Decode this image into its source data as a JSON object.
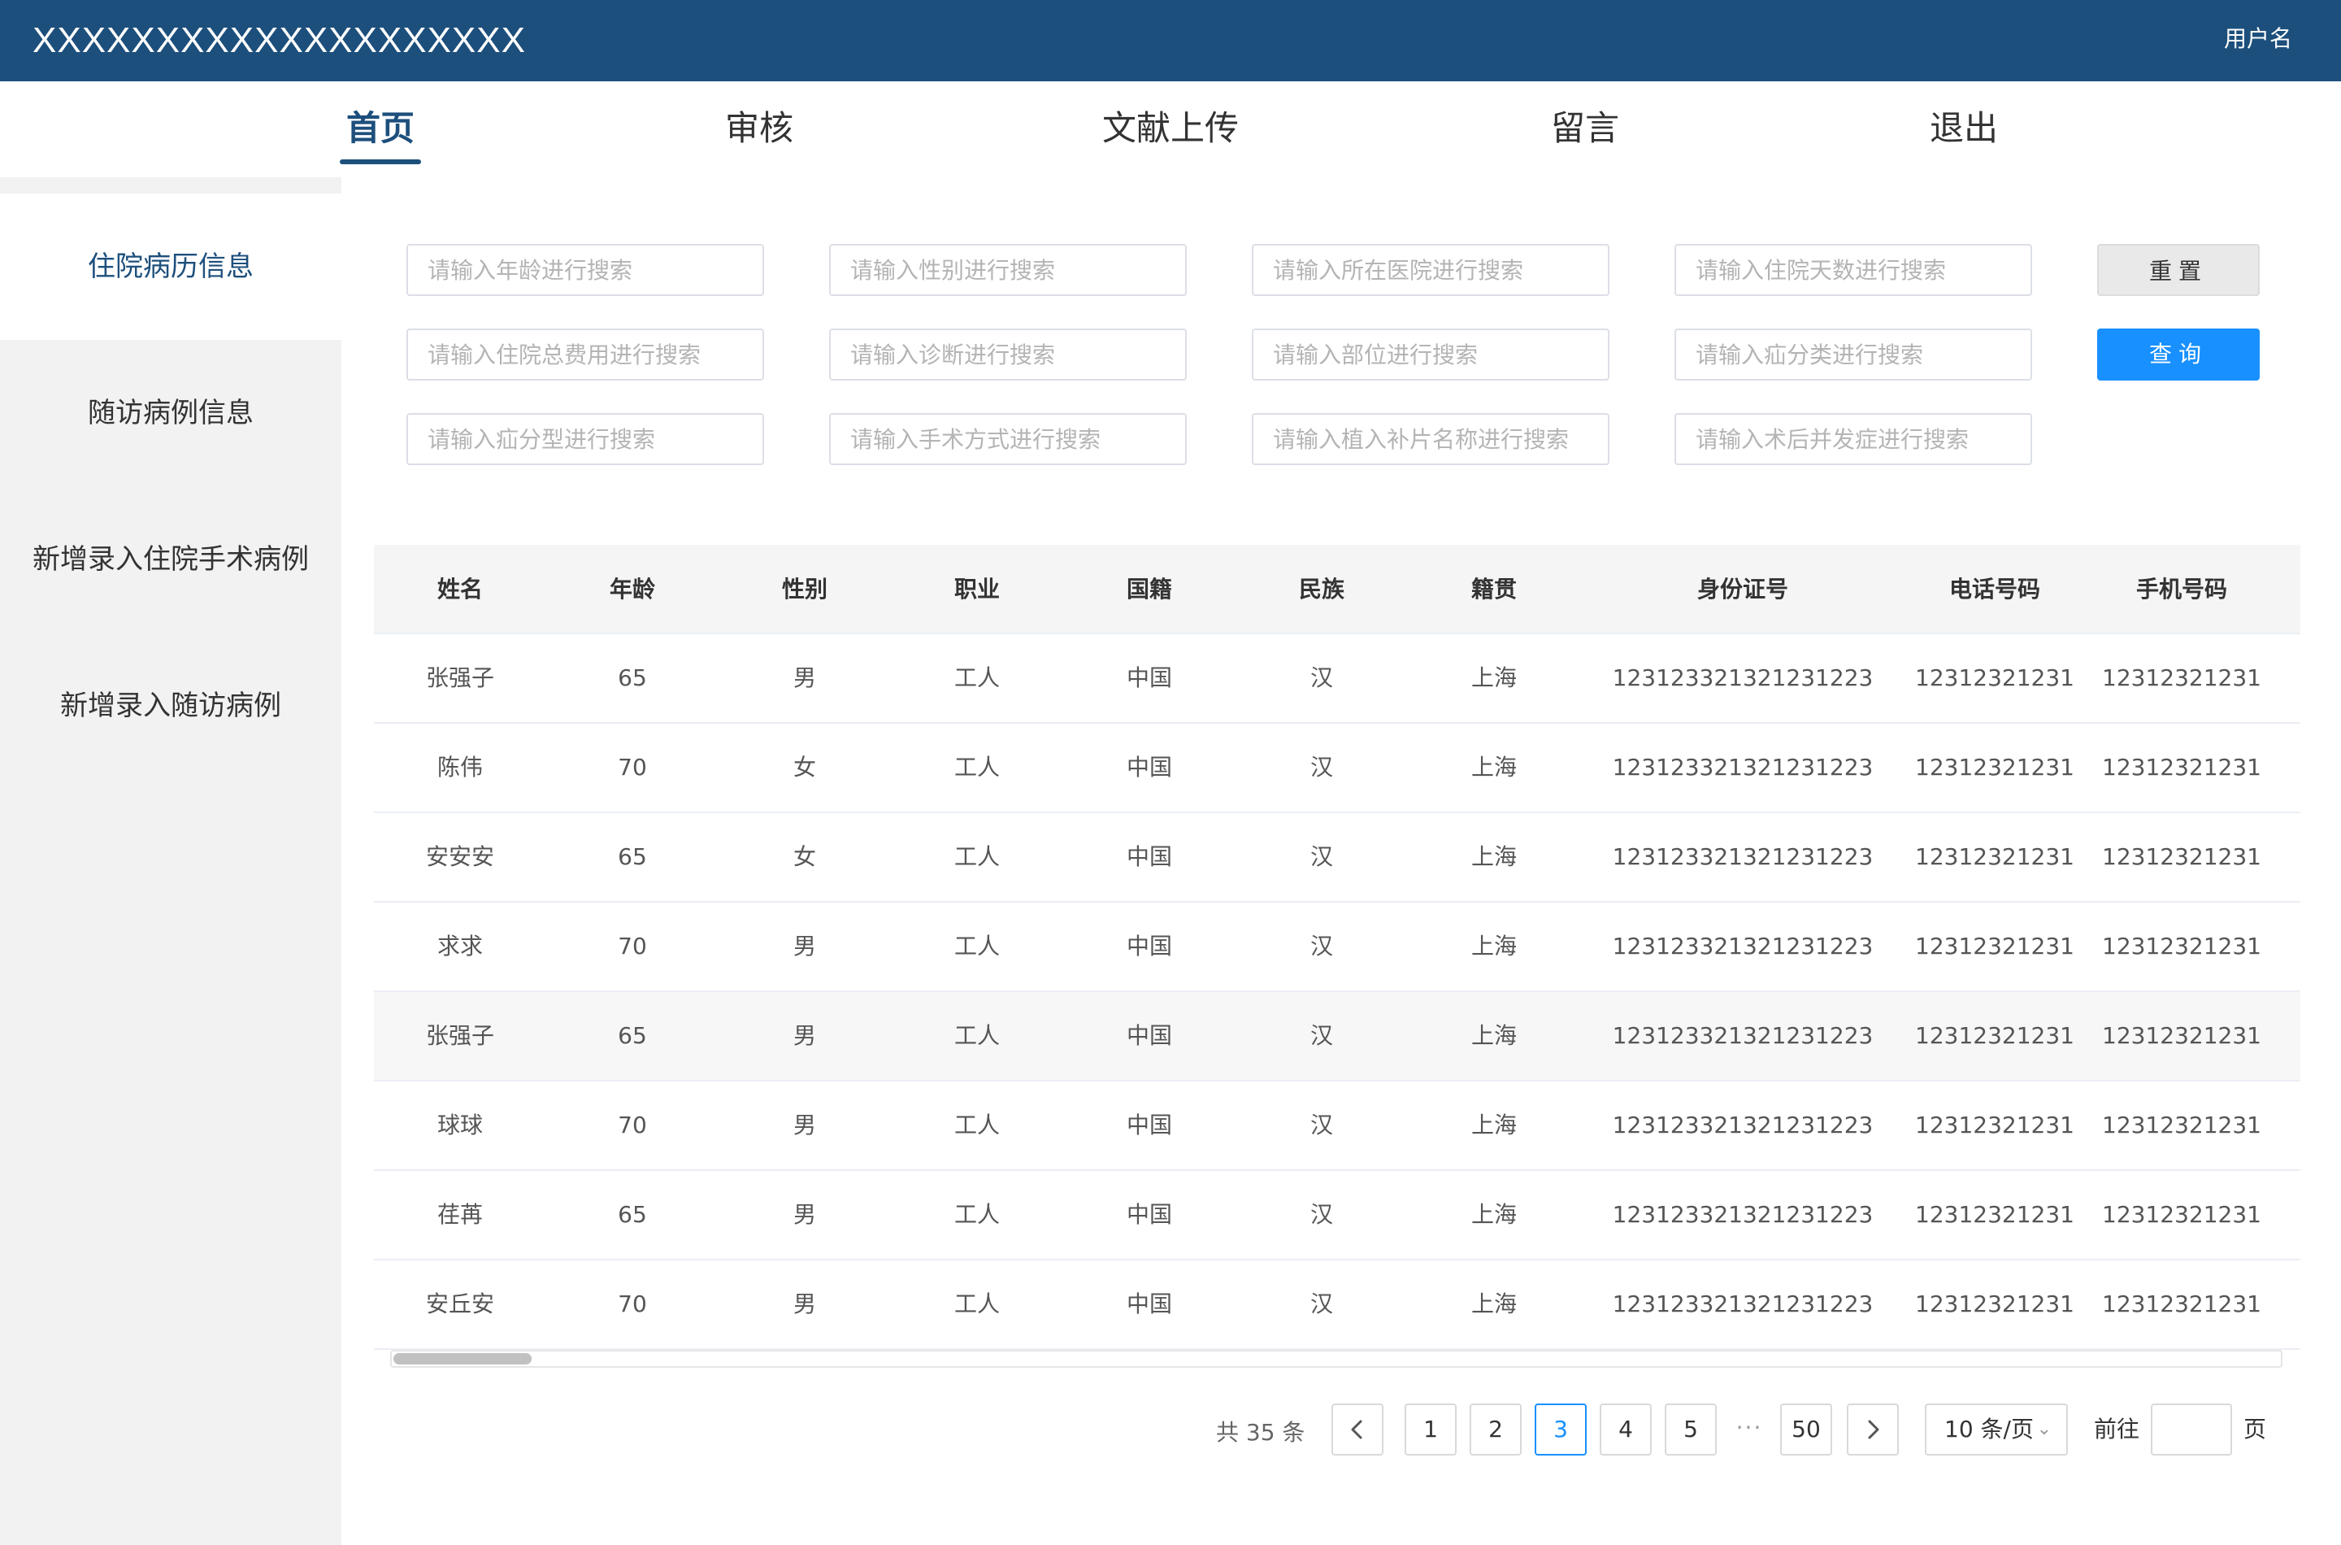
{
  "header": {
    "app_title": "XXXXXXXXXXXXXXXXXXXX",
    "username": "用户名"
  },
  "nav": {
    "tabs": [
      {
        "label": "首页"
      },
      {
        "label": "审核"
      },
      {
        "label": "文献上传"
      },
      {
        "label": "留言"
      },
      {
        "label": "退出"
      }
    ],
    "active_index": 0
  },
  "sidebar": {
    "items": [
      {
        "label": "住院病历信息"
      },
      {
        "label": "随访病例信息"
      },
      {
        "label": "新增录入住院手术病例"
      },
      {
        "label": "新增录入随访病例"
      }
    ],
    "active_index": 0
  },
  "search": {
    "placeholders": [
      "请输入年龄进行搜索",
      "请输入性别进行搜索",
      "请输入所在医院进行搜索",
      "请输入住院天数进行搜索",
      "请输入住院总费用进行搜索",
      "请输入诊断进行搜索",
      "请输入部位进行搜索",
      "请输入疝分类进行搜索",
      "请输入疝分型进行搜索",
      "请输入手术方式进行搜索",
      "请输入植入补片名称进行搜索",
      "请输入术后并发症进行搜索"
    ],
    "reset_label": "重置",
    "query_label": "查询"
  },
  "table": {
    "columns": [
      "姓名",
      "年龄",
      "性别",
      "职业",
      "国籍",
      "民族",
      "籍贯",
      "身份证号",
      "电话号码",
      "手机号码"
    ],
    "rows": [
      [
        "张强子",
        "65",
        "男",
        "工人",
        "中国",
        "汉",
        "上海",
        "123123321321231223",
        "12312321231",
        "12312321231"
      ],
      [
        "陈伟",
        "70",
        "女",
        "工人",
        "中国",
        "汉",
        "上海",
        "123123321321231223",
        "12312321231",
        "12312321231"
      ],
      [
        "安安安",
        "65",
        "女",
        "工人",
        "中国",
        "汉",
        "上海",
        "123123321321231223",
        "12312321231",
        "12312321231"
      ],
      [
        "求求",
        "70",
        "男",
        "工人",
        "中国",
        "汉",
        "上海",
        "123123321321231223",
        "12312321231",
        "12312321231"
      ],
      [
        "张强子",
        "65",
        "男",
        "工人",
        "中国",
        "汉",
        "上海",
        "123123321321231223",
        "12312321231",
        "12312321231"
      ],
      [
        "球球",
        "70",
        "男",
        "工人",
        "中国",
        "汉",
        "上海",
        "123123321321231223",
        "12312321231",
        "12312321231"
      ],
      [
        "荏苒",
        "65",
        "男",
        "工人",
        "中国",
        "汉",
        "上海",
        "123123321321231223",
        "12312321231",
        "12312321231"
      ],
      [
        "安丘安",
        "70",
        "男",
        "工人",
        "中国",
        "汉",
        "上海",
        "123123321321231223",
        "12312321231",
        "12312321231"
      ]
    ],
    "highlighted_row": 4
  },
  "pagination": {
    "total_text": "共 35 条",
    "pages": [
      "1",
      "2",
      "3",
      "4",
      "5"
    ],
    "ellipsis": "···",
    "last_page": "50",
    "current_page": "3",
    "page_size_label": "10 条/页",
    "goto_label": "前往",
    "page_suffix": "页",
    "icons": {
      "prev": "chevron-left-icon",
      "next": "chevron-right-icon",
      "dropdown": "chevron-down-icon"
    }
  }
}
